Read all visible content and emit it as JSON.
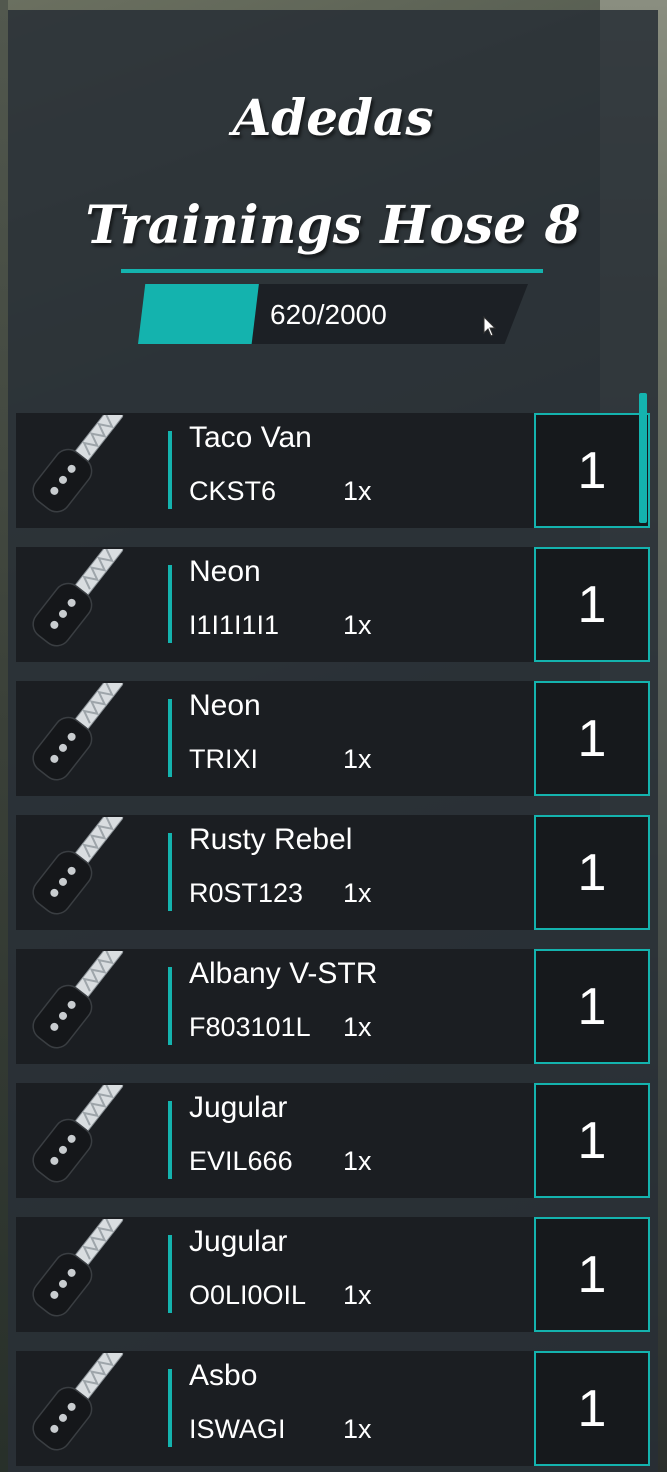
{
  "header": {
    "title_line1": "Adedas",
    "title_line2": "Trainings Hose 8"
  },
  "progress": {
    "label": "620/2000",
    "current": 620,
    "max": 2000
  },
  "items": [
    {
      "name": "Taco Van",
      "plate": "CKST6",
      "quantity": "1x",
      "amount": "1"
    },
    {
      "name": "Neon",
      "plate": "I1I1I1I1",
      "quantity": "1x",
      "amount": "1"
    },
    {
      "name": "Neon",
      "plate": "TRIXI",
      "quantity": "1x",
      "amount": "1"
    },
    {
      "name": "Rusty Rebel",
      "plate": "R0ST123",
      "quantity": "1x",
      "amount": "1"
    },
    {
      "name": "Albany V-STR",
      "plate": "F803101L",
      "quantity": "1x",
      "amount": "1"
    },
    {
      "name": "Jugular",
      "plate": "EVIL666",
      "quantity": "1x",
      "amount": "1"
    },
    {
      "name": "Jugular",
      "plate": "O0LI0OIL",
      "quantity": "1x",
      "amount": "1"
    },
    {
      "name": "Asbo",
      "plate": "ISWAGI",
      "quantity": "1x",
      "amount": "1"
    }
  ],
  "icons": {
    "item_icon": "car-key-icon",
    "cursor": "mouse-cursor-icon"
  },
  "colors": {
    "accent": "#14b3ae",
    "row_background": "#1b1e22",
    "panel_background": "#282e36"
  }
}
